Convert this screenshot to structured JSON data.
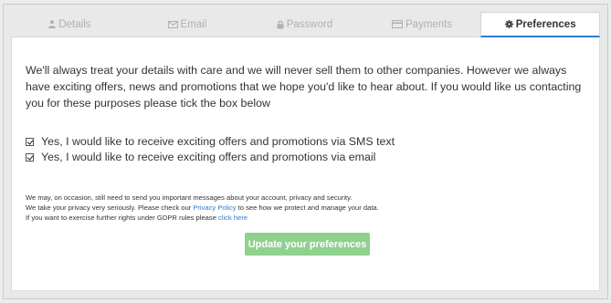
{
  "tabs": [
    {
      "label": "Details",
      "icon": "user-icon"
    },
    {
      "label": "Email",
      "icon": "envelope-icon"
    },
    {
      "label": "Password",
      "icon": "lock-icon"
    },
    {
      "label": "Payments",
      "icon": "credit-card-icon"
    },
    {
      "label": "Preferences",
      "icon": "gear-icon",
      "active": true
    }
  ],
  "intro_text": "We'll always treat your details with care and we will never sell them to other companies. However we always have exciting offers, news and promotions that we hope you'd like to hear about. If you would like us contacting you for these purposes please tick the box below",
  "checkboxes": [
    {
      "label": "Yes, I would like to receive exciting offers and promotions via SMS text",
      "checked": true
    },
    {
      "label": "Yes, I would like to receive exciting offers and promotions via email",
      "checked": true
    }
  ],
  "notice": {
    "line1": "We may, on occasion, still need to send you important messages about your account, privacy and security.",
    "line2_before": "We take your privacy very seriously. Please check our ",
    "line2_link": "Privacy Policy",
    "line2_after": " to see how we protect and manage your data.",
    "line3_before": "If you want to exercise further rights under GDPR rules please ",
    "line3_link": "click here"
  },
  "update_button": "Update your preferences",
  "colors": {
    "accent": "#2d7bd4",
    "button": "#8fd18f",
    "inactive_tab_text": "#b0b0b0"
  }
}
